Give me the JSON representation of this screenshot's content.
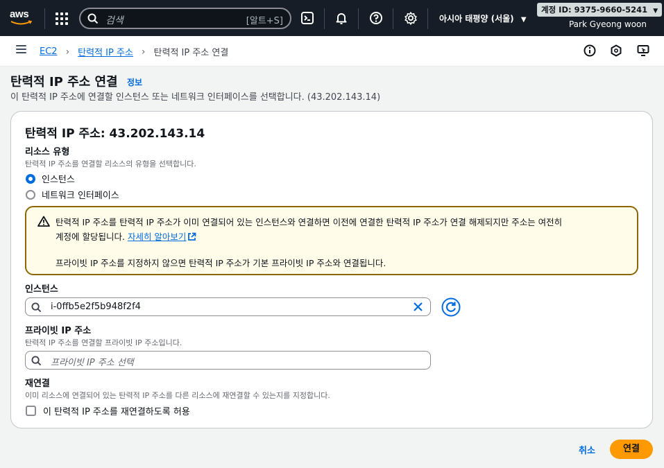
{
  "nav": {
    "logo": "aws",
    "search_placeholder": "검색",
    "search_shortcut": "[알트+S]",
    "region": "아시아 태평양 (서울)",
    "account": "계정 ID: 9375-9660-5241",
    "user": "Park Gyeong woon"
  },
  "breadcrumb": {
    "items": [
      "EC2",
      "탄력적 IP 주소"
    ],
    "current": "탄력적 IP 주소 연결"
  },
  "header": {
    "title": "탄력적 IP 주소 연결",
    "info": "정보",
    "description": "이 탄력적 IP 주소에 연결할 인스턴스 또는 네트워크 인터페이스를 선택합니다. (43.202.143.14)"
  },
  "form": {
    "title": "탄력적 IP 주소: 43.202.143.14",
    "resource_type": {
      "label": "리소스 유형",
      "hint": "탄력적 IP 주소를 연결할 리소스의 유형을 선택합니다.",
      "options": [
        "인스턴스",
        "네트워크 인터페이스"
      ],
      "selected": "인스턴스"
    },
    "alert": {
      "line1": "탄력적 IP 주소를 탄력적 IP 주소가 이미 연결되어 있는 인스턴스와 연결하면 이전에 연결한 탄력적 IP 주소가 연결 해제되지만 주소는 여전히",
      "line2": "계정에 할당됩니다.",
      "link": "자세히 알아보기",
      "line3": "프라이빗 IP 주소를 지정하지 않으면 탄력적 IP 주소가 기본 프라이빗 IP 주소와 연결됩니다."
    },
    "instance": {
      "label": "인스턴스",
      "value": "i-0ffb5e2f5b948f2f4"
    },
    "private_ip": {
      "label": "프라이빗 IP 주소",
      "hint": "탄력적 IP 주소를 연결할 프라이빗 IP 주소입니다.",
      "placeholder": "프라이빗 IP 주소 선택"
    },
    "reassociate": {
      "label": "재연결",
      "hint": "이미 리소스에 연결되어 있는 탄력적 IP 주소를 다른 리소스에 재연결할 수 있는지를 지정합니다.",
      "checkbox_label": "이 탄력적 IP 주소를 재연결하도록 허용",
      "checked": false
    }
  },
  "actions": {
    "cancel": "취소",
    "submit": "연결"
  },
  "colors": {
    "nav_bg": "#161d26",
    "link": "#006ce0",
    "primary_button": "#ff9900",
    "alert_border": "#8d6605",
    "alert_bg": "#fffce9"
  }
}
